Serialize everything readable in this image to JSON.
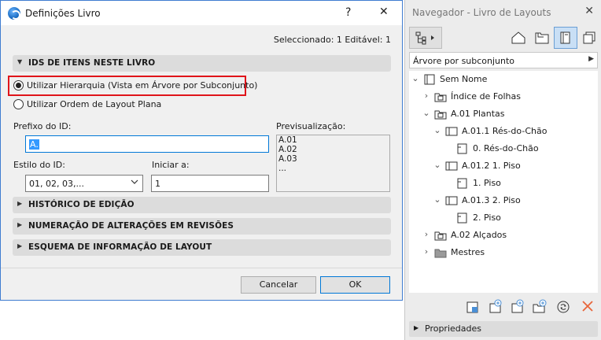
{
  "dialog": {
    "title": "Definições Livro",
    "help_label": "?",
    "close_label": "✕",
    "selection_status": "Seleccionado: 1 Editável: 1",
    "sections": {
      "ids": "IDS DE ITENS NESTE LIVRO",
      "history": "HISTÓRICO DE EDIÇÃO",
      "revisions": "NUMERAÇÃO DE ALTERAÇÕES EM REVISÕES",
      "schema": "ESQUEMA DE INFORMAÇÃO DE LAYOUT"
    },
    "radio_hierarchy": "Utilizar Hierarquia (Vista em Árvore por Subconjunto)",
    "radio_flat": "Utilizar Ordem de Layout Plana",
    "prefix_label": "Prefixo do ID:",
    "prefix_value": "A.",
    "style_label": "Estilo do ID:",
    "style_value": "01, 02, 03,...",
    "start_label": "Iniciar a:",
    "start_value": "1",
    "preview_label": "Previsualização:",
    "preview_lines": [
      "A.01",
      "A.02",
      "A.03",
      "..."
    ],
    "cancel_label": "Cancelar",
    "ok_label": "OK"
  },
  "navigator": {
    "title": "Navegador - Livro de Layouts",
    "close_label": "✕",
    "view_mode": "Árvore por subconjunto",
    "tree": {
      "root": "Sem Nome",
      "index": "Índice de Folhas",
      "plantas": "A.01 Plantas",
      "res_chao_set": "A.01.1 Rés-do-Chão",
      "res_chao_layout": "0. Rés-do-Chão",
      "piso1_set": "A.01.2 1. Piso",
      "piso1_layout": "1. Piso",
      "piso2_set": "A.01.3 2. Piso",
      "piso2_layout": "2. Piso",
      "alcados": "A.02 Alçados",
      "mestres": "Mestres"
    },
    "properties_label": "Propriedades"
  },
  "colors": {
    "highlight": "#e0141a",
    "accent": "#0078d7",
    "delete": "#e8653a"
  }
}
